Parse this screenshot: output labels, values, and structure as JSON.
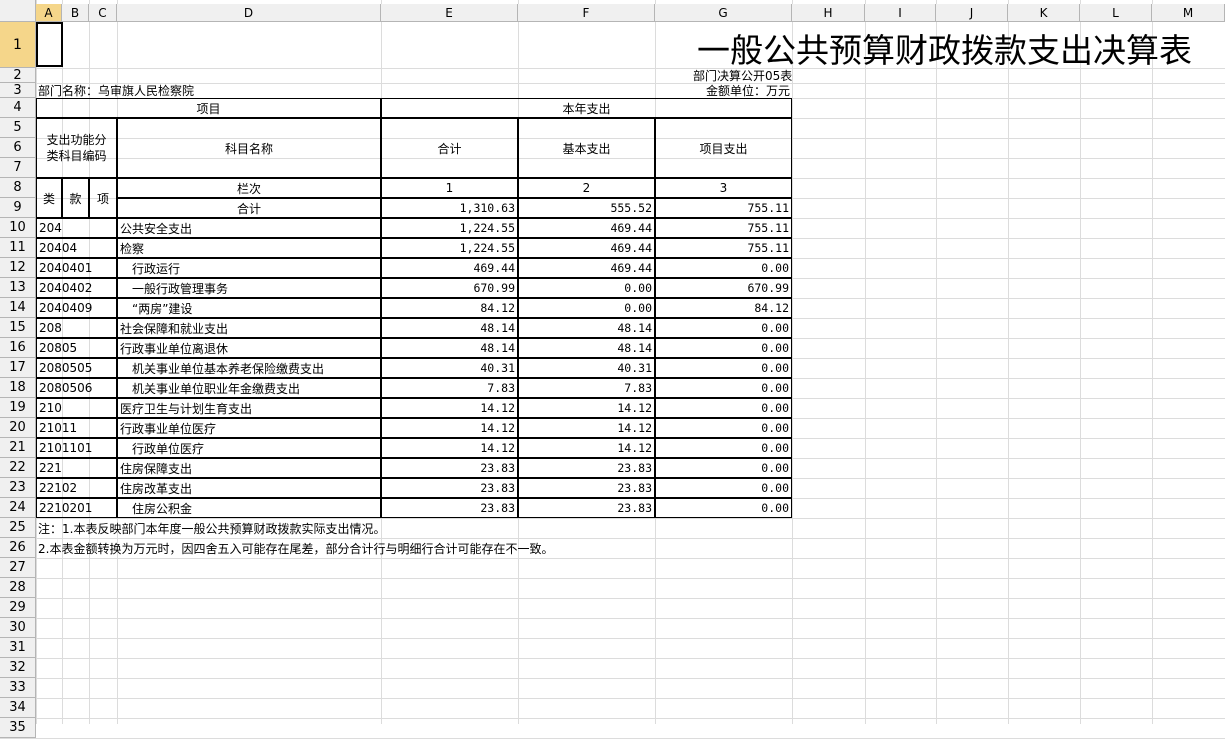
{
  "columns": [
    "A",
    "B",
    "C",
    "D",
    "E",
    "F",
    "G",
    "H",
    "I",
    "J",
    "K",
    "L",
    "M"
  ],
  "rows": [
    "1",
    "2",
    "3",
    "4",
    "5",
    "6",
    "7",
    "8",
    "9",
    "10",
    "11",
    "12",
    "13",
    "14",
    "15",
    "16",
    "17",
    "18",
    "19",
    "20",
    "21",
    "22",
    "23",
    "24",
    "25",
    "26",
    "27",
    "28",
    "29",
    "30",
    "31",
    "32",
    "33",
    "34",
    "35"
  ],
  "title": "一般公共预算财政拨款支出决算表",
  "report_code": "部门决算公开05表",
  "department": "部门名称：乌审旗人民检察院",
  "unit": "金额单位：万元",
  "header": {
    "project": "项目",
    "current_year": "本年支出",
    "func_code": "支出功能分类科目编码",
    "subject_name": "科目名称",
    "total": "合计",
    "basic": "基本支出",
    "project_exp": "项目支出",
    "lei": "类",
    "kuan": "款",
    "xiang": "项",
    "lanci": "栏次",
    "col1": "1",
    "col2": "2",
    "col3": "3"
  },
  "total_row": {
    "label": "合计",
    "total": "1,310.63",
    "basic": "555.52",
    "project": "755.11"
  },
  "data_rows": [
    {
      "code": "204",
      "name": "公共安全支出",
      "total": "1,224.55",
      "basic": "469.44",
      "project": "755.11"
    },
    {
      "code": "20404",
      "name": "检察",
      "total": "1,224.55",
      "basic": "469.44",
      "project": "755.11"
    },
    {
      "code": "2040401",
      "name": "　行政运行",
      "total": "469.44",
      "basic": "469.44",
      "project": "0.00"
    },
    {
      "code": "2040402",
      "name": "　一般行政管理事务",
      "total": "670.99",
      "basic": "0.00",
      "project": "670.99"
    },
    {
      "code": "2040409",
      "name": "　“两房”建设",
      "total": "84.12",
      "basic": "0.00",
      "project": "84.12"
    },
    {
      "code": "208",
      "name": "社会保障和就业支出",
      "total": "48.14",
      "basic": "48.14",
      "project": "0.00"
    },
    {
      "code": "20805",
      "name": "行政事业单位离退休",
      "total": "48.14",
      "basic": "48.14",
      "project": "0.00"
    },
    {
      "code": "2080505",
      "name": "　机关事业单位基本养老保险缴费支出",
      "total": "40.31",
      "basic": "40.31",
      "project": "0.00"
    },
    {
      "code": "2080506",
      "name": "　机关事业单位职业年金缴费支出",
      "total": "7.83",
      "basic": "7.83",
      "project": "0.00"
    },
    {
      "code": "210",
      "name": "医疗卫生与计划生育支出",
      "total": "14.12",
      "basic": "14.12",
      "project": "0.00"
    },
    {
      "code": "21011",
      "name": "行政事业单位医疗",
      "total": "14.12",
      "basic": "14.12",
      "project": "0.00"
    },
    {
      "code": "2101101",
      "name": "　行政单位医疗",
      "total": "14.12",
      "basic": "14.12",
      "project": "0.00"
    },
    {
      "code": "221",
      "name": "住房保障支出",
      "total": "23.83",
      "basic": "23.83",
      "project": "0.00"
    },
    {
      "code": "22102",
      "name": "住房改革支出",
      "total": "23.83",
      "basic": "23.83",
      "project": "0.00"
    },
    {
      "code": "2210201",
      "name": "　住房公积金",
      "total": "23.83",
      "basic": "23.83",
      "project": "0.00"
    }
  ],
  "notes": [
    "注：1.本表反映部门本年度一般公共预算财政拨款实际支出情况。",
    "2.本表金额转换为万元时，因四舍五入可能存在尾差，部分合计行与明细行合计可能存在不一致。"
  ]
}
